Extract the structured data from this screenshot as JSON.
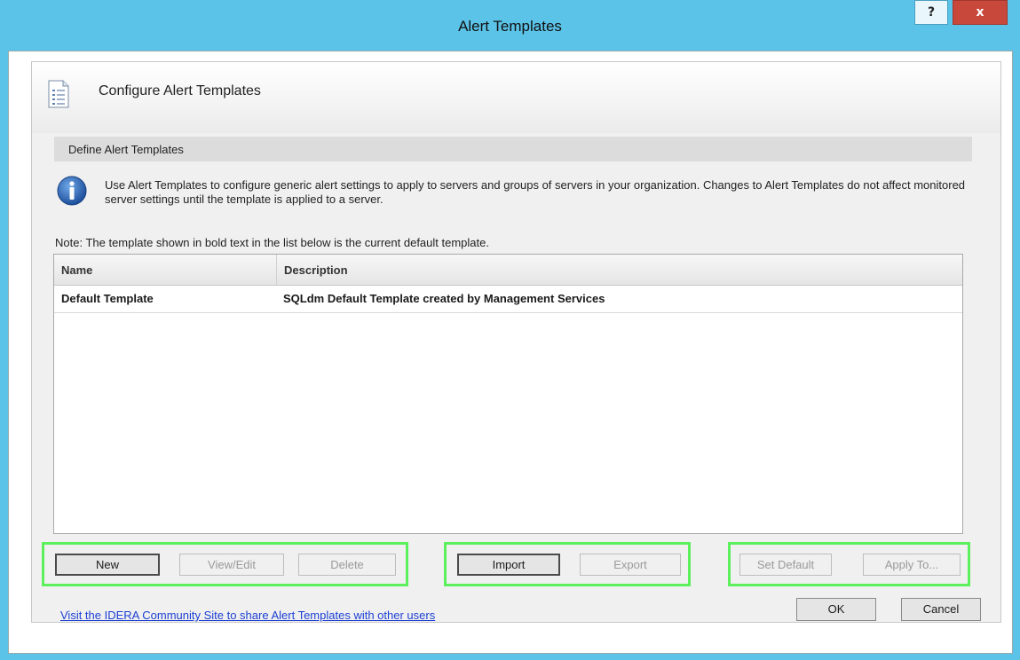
{
  "window": {
    "title": "Alert Templates",
    "help_label": "?",
    "close_label": "x"
  },
  "header": {
    "title": "Configure Alert Templates",
    "icon": "document-list-icon"
  },
  "section": {
    "title": "Define Alert Templates"
  },
  "info": {
    "icon": "info-icon",
    "text": "Use Alert Templates to configure generic alert settings to apply to servers and groups of servers in your organization.  Changes to Alert Templates do not affect monitored server settings until the template is applied to a server."
  },
  "note": "Note:  The template shown in bold text in the list below is the current default template.",
  "list": {
    "columns": [
      "Name",
      "Description"
    ],
    "rows": [
      {
        "name": "Default Template",
        "description": "SQLdm Default Template created by Management Services"
      }
    ]
  },
  "buttons": {
    "new": "New",
    "view_edit": "View/Edit",
    "delete": "Delete",
    "import": "Import",
    "export": "Export",
    "set_default": "Set Default",
    "apply_to": "Apply To...",
    "ok": "OK",
    "cancel": "Cancel"
  },
  "link": "Visit the IDERA Community Site to share Alert Templates with other users",
  "colors": {
    "title_bar": "#5bc3e8",
    "highlight_box": "#5cf05c",
    "close_button": "#c9483c",
    "link": "#1c3fd4"
  }
}
